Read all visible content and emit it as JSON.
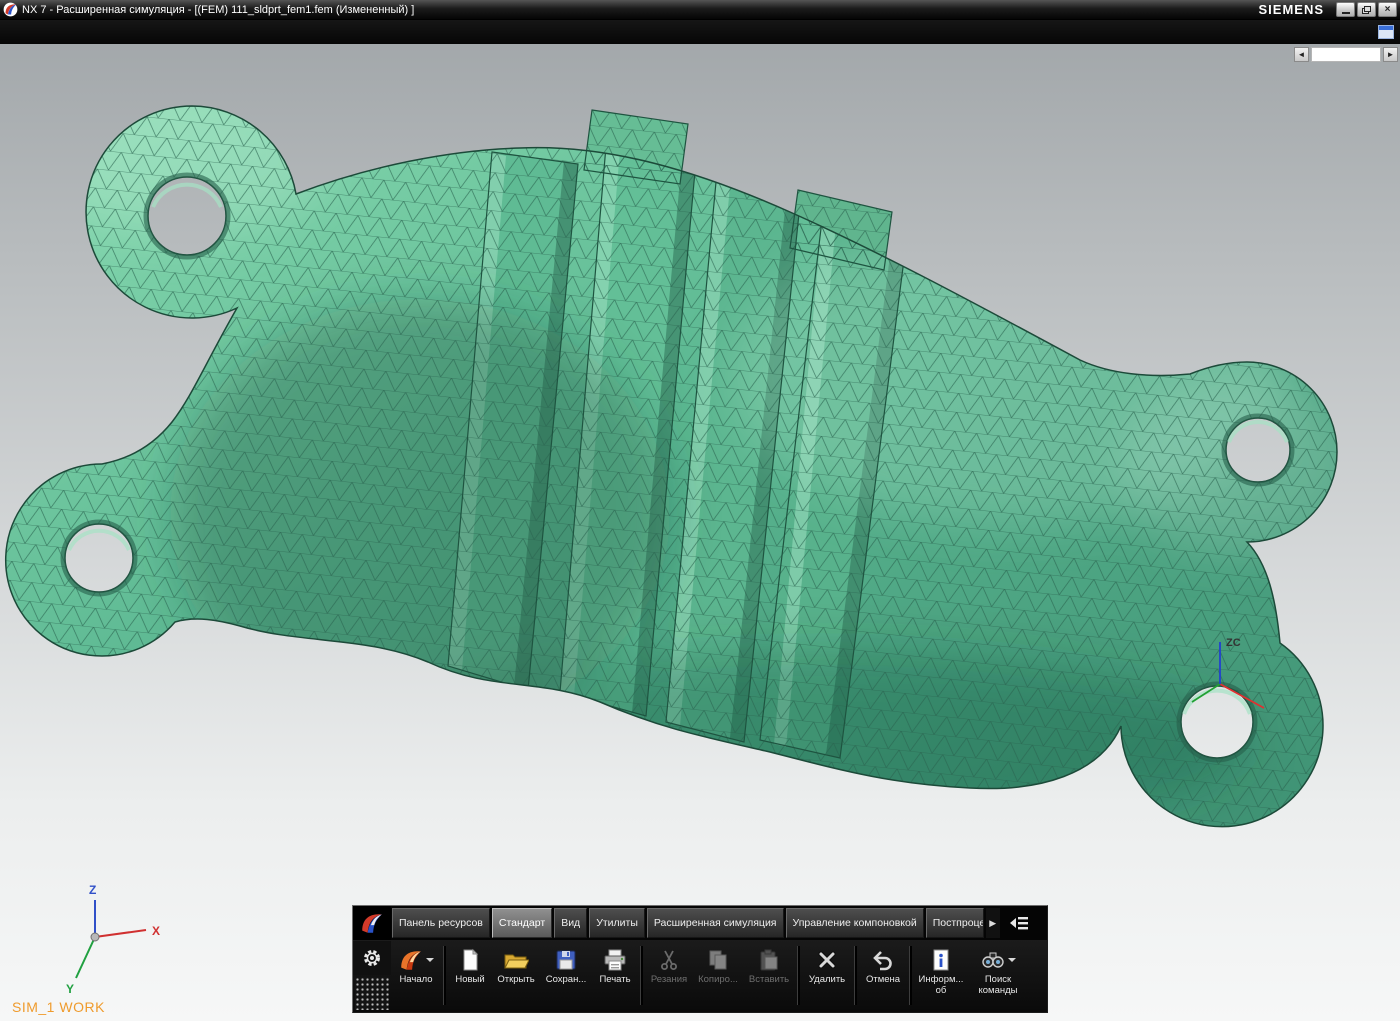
{
  "window": {
    "title": "NX 7 - Расширенная симуляция - [(FEM) 111_sldprt_fem1.fem (Измененный) ]",
    "brand": "SIEMENS",
    "controls": {
      "minimize": "minimize",
      "restore": "restore",
      "close": "×"
    }
  },
  "dock": {
    "scroll_left": "◄",
    "scroll_right": "►"
  },
  "viewport": {
    "status_label": "SIM_1 WORK",
    "triad": {
      "x_label": "X",
      "y_label": "Y",
      "z_label": "Z"
    },
    "csys_label": "ZC",
    "model_description": "Tetrahedral FEM mesh of a bracket with four ring lugs and four slanted ribs",
    "colors": {
      "mesh_fill": "#5cb892",
      "mesh_fill_light": "#86d8af",
      "mesh_fill_dark": "#3e9173",
      "mesh_line": "#2a6450",
      "edge": "#1c4a39",
      "background_top": "#a3a8ab",
      "background_bottom": "#f6f7f7",
      "status_label_color": "#ef9b2d"
    }
  },
  "toolbar": {
    "tabs": [
      {
        "label": "Панель ресурсов",
        "active": false
      },
      {
        "label": "Стандарт",
        "active": true
      },
      {
        "label": "Вид",
        "active": false
      },
      {
        "label": "Утилиты",
        "active": false
      },
      {
        "label": "Расширенная симуляция",
        "active": false
      },
      {
        "label": "Управление компоновкой",
        "active": false
      },
      {
        "label": "Постпроцес",
        "active": false
      }
    ],
    "overflow_arrow": "▶",
    "buttons": [
      {
        "label": "Начало",
        "icon": "nx-start-icon",
        "enabled": true,
        "dropdown": true
      },
      {
        "label": "Новый",
        "icon": "new-document-icon",
        "enabled": true
      },
      {
        "label": "Открыть",
        "icon": "open-folder-icon",
        "enabled": true
      },
      {
        "label": "Сохран...",
        "icon": "save-icon",
        "enabled": true
      },
      {
        "label": "Печать",
        "icon": "print-icon",
        "enabled": true
      },
      {
        "label": "Резания",
        "icon": "cut-icon",
        "enabled": false
      },
      {
        "label": "Копиро...",
        "icon": "copy-icon",
        "enabled": false
      },
      {
        "label": "Вставить",
        "icon": "paste-icon",
        "enabled": false
      },
      {
        "label": "Удалить",
        "icon": "delete-icon",
        "enabled": true
      },
      {
        "label": "Отмена",
        "icon": "undo-icon",
        "enabled": true
      },
      {
        "label": "Информ... об",
        "icon": "info-icon",
        "enabled": true
      },
      {
        "label": "Поиск команды",
        "icon": "find-command-icon",
        "enabled": true,
        "dropdown": true
      }
    ]
  }
}
